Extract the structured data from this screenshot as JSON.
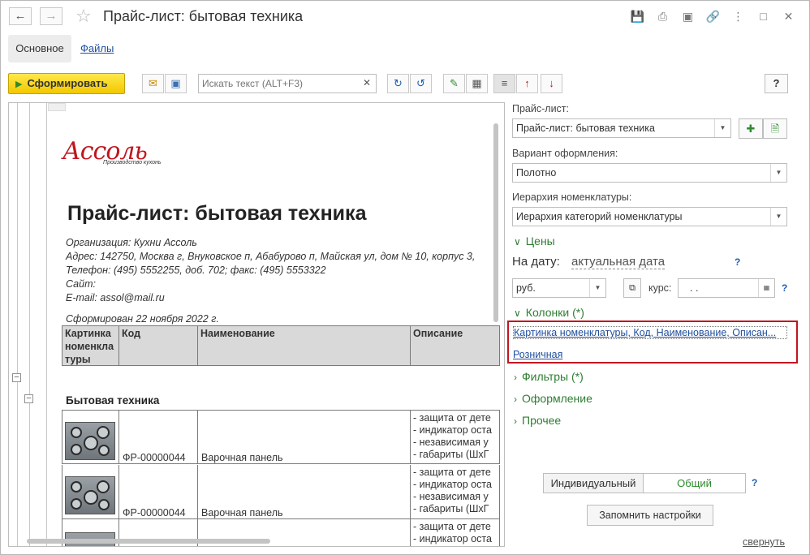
{
  "window": {
    "title": "Прайс-лист: бытовая техника",
    "back_icon": "arrow-left",
    "forward_icon": "arrow-right",
    "star_icon": "star"
  },
  "tabs": {
    "main": "Основное",
    "files": "Файлы"
  },
  "toolbar": {
    "generate_label": "Сформировать",
    "search_placeholder": "Искать текст (ALT+F3)",
    "help_label": "?"
  },
  "document": {
    "logo_text": "Ассоль",
    "logo_subtitle": "Производство кухонь",
    "title": "Прайс-лист: бытовая техника",
    "org": "Организация: Кухни Ассоль",
    "address": "Адрес: 142750, Москва г, Внуковское п, Абабурово п, Майская ул, дом № 10, корпус 3,",
    "phone": "Телефон: (495) 5552255, доб. 702; факс: (495) 5553322",
    "site": "Сайт:",
    "email": "E-mail: assol@mail.ru",
    "generated": "Сформирован 22 ноября 2022 г.",
    "headers": {
      "picture": "Картинка номенклатуры",
      "code": "Код",
      "name": "Наименование",
      "description": "Описание"
    },
    "section": "Бытовая техника",
    "rows": [
      {
        "code": "ФР-00000044",
        "name": "Варочная панель",
        "desc": [
          "- защита от дете",
          "- индикатор оста",
          "- независимая у",
          "- габариты (ШхГ"
        ]
      },
      {
        "code": "ФР-00000044",
        "name": "Варочная панель",
        "desc": [
          "- защита от дете",
          "- индикатор оста",
          "- независимая у",
          "- габариты (ШхГ"
        ]
      },
      {
        "code": "",
        "name": "",
        "desc": [
          "- защита от дете",
          "- индикатор оста"
        ]
      }
    ]
  },
  "panel": {
    "pricelist_label": "Прайс-лист:",
    "pricelist_value": "Прайс-лист: бытовая техника",
    "variant_label": "Вариант оформления:",
    "variant_value": "Полотно",
    "hierarchy_label": "Иерархия номенклатуры:",
    "hierarchy_value": "Иерархия категорий номенклатуры",
    "prices_group": "Цены",
    "date_label": "На дату:",
    "date_value": "актуальная дата",
    "currency": "руб.",
    "rate_label": "курс:",
    "rate_value": ". .",
    "columns_group": "Колонки (*)",
    "columns_link": "Картинка номенклатуры, Код, Наименование, Описан...",
    "retail_link": "Розничная",
    "filters_group": "Фильтры (*)",
    "design_group": "Оформление",
    "other_group": "Прочее",
    "seg_individual": "Индивидуальный",
    "seg_common": "Общий",
    "save_settings": "Запомнить настройки",
    "collapse_link": "свернуть",
    "help": "?"
  }
}
